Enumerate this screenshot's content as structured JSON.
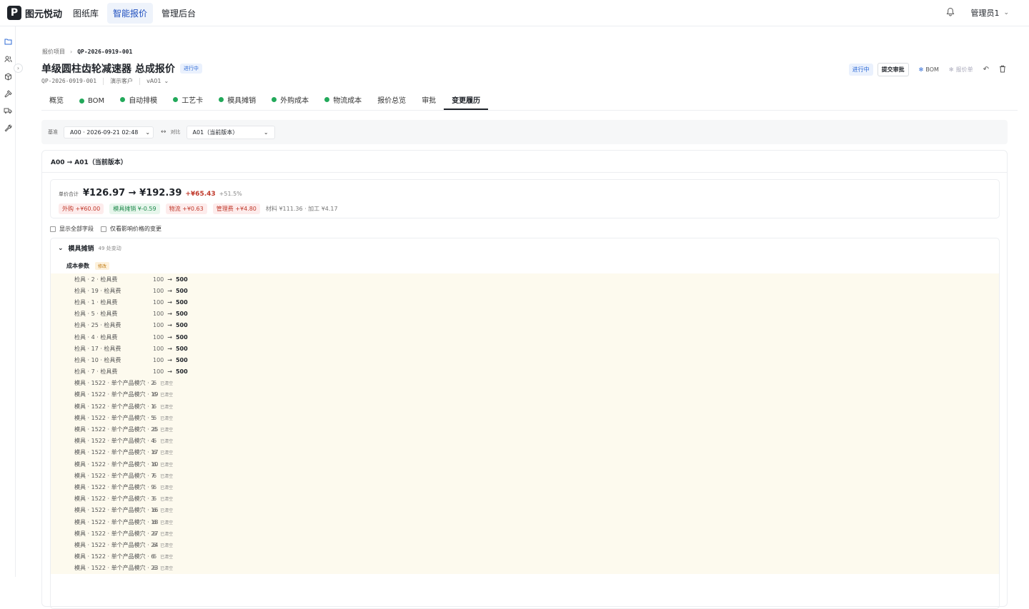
{
  "app": {
    "logo_letter": "P",
    "name": "图元悦动"
  },
  "nav": [
    {
      "label": "图纸库",
      "active": false
    },
    {
      "label": "智能报价",
      "active": true
    },
    {
      "label": "管理后台",
      "active": false
    }
  ],
  "user": {
    "name": "管理员1"
  },
  "breadcrumb": {
    "parent": "报价项目",
    "current": "QP-2026-0919-001"
  },
  "header": {
    "title": "单级圆柱齿轮减速器 总成报价",
    "status": "进行中",
    "code": "QP-2026-0919-001",
    "customer": "演示客户",
    "version": "vA01"
  },
  "actions": {
    "status": "进行中",
    "submit": "提交审批",
    "bom": "BOM",
    "quote_sheet": "报价单"
  },
  "tabs": [
    {
      "label": "概览",
      "dot": false
    },
    {
      "label": "BOM",
      "dot": true
    },
    {
      "label": "自动排模",
      "dot": true
    },
    {
      "label": "工艺卡",
      "dot": true
    },
    {
      "label": "模具摊销",
      "dot": true
    },
    {
      "label": "外购成本",
      "dot": true
    },
    {
      "label": "物流成本",
      "dot": true
    },
    {
      "label": "报价总览",
      "dot": false
    },
    {
      "label": "审批",
      "dot": false
    },
    {
      "label": "变更履历",
      "dot": false,
      "active": true
    }
  ],
  "filter": {
    "base_label": "基准",
    "base_value": "A00 · 2026-09-21 02:48",
    "compare_label": "对比",
    "compare_value": "A01（当前版本）"
  },
  "diff": {
    "heading": "A00 → A01（当前版本）",
    "summary": {
      "label": "单价合计",
      "price": "¥126.97 → ¥192.39",
      "delta": "+¥65.43",
      "pct": "+51.5%",
      "chips": [
        {
          "text": "外购 +¥60.00",
          "tone": "red"
        },
        {
          "text": "模具摊销 ¥-0.59",
          "tone": "green"
        },
        {
          "text": "物流 +¥0.63",
          "tone": "red"
        },
        {
          "text": "管理费 +¥4.80",
          "tone": "red"
        }
      ],
      "extra": "材料 ¥111.36 · 加工 ¥4.17"
    },
    "options": {
      "show_all": "显示全部字段",
      "price_only": "仅看影响价格的变更"
    },
    "section": {
      "title": "模具摊销",
      "count": "49 处变动",
      "group": {
        "title": "成本参数",
        "badge": "修改"
      },
      "changes": [
        {
          "name": "检具 · 2 · 检具费",
          "from": "100",
          "to": "500"
        },
        {
          "name": "检具 · 19 · 检具费",
          "from": "100",
          "to": "500"
        },
        {
          "name": "检具 · 1 · 检具费",
          "from": "100",
          "to": "500"
        },
        {
          "name": "检具 · 5 · 检具费",
          "from": "100",
          "to": "500"
        },
        {
          "name": "检具 · 25 · 检具费",
          "from": "100",
          "to": "500"
        },
        {
          "name": "检具 · 4 · 检具费",
          "from": "100",
          "to": "500"
        },
        {
          "name": "检具 · 17 · 检具费",
          "from": "100",
          "to": "500"
        },
        {
          "name": "检具 · 10 · 检具费",
          "from": "100",
          "to": "500"
        },
        {
          "name": "检具 · 7 · 检具费",
          "from": "100",
          "to": "500"
        },
        {
          "name": "模具 · 1522 · 单个产品模穴 · 2",
          "from": "6",
          "cleared": "已清空"
        },
        {
          "name": "模具 · 1522 · 单个产品模穴 · 19",
          "from": "6",
          "cleared": "已清空"
        },
        {
          "name": "模具 · 1522 · 单个产品模穴 · 1",
          "from": "6",
          "cleared": "已清空"
        },
        {
          "name": "模具 · 1522 · 单个产品模穴 · 5",
          "from": "6",
          "cleared": "已清空"
        },
        {
          "name": "模具 · 1522 · 单个产品模穴 · 25",
          "from": "6",
          "cleared": "已清空"
        },
        {
          "name": "模具 · 1522 · 单个产品模穴 · 4",
          "from": "6",
          "cleared": "已清空"
        },
        {
          "name": "模具 · 1522 · 单个产品模穴 · 17",
          "from": "6",
          "cleared": "已清空"
        },
        {
          "name": "模具 · 1522 · 单个产品模穴 · 10",
          "from": "6",
          "cleared": "已清空"
        },
        {
          "name": "模具 · 1522 · 单个产品模穴 · 7",
          "from": "6",
          "cleared": "已清空"
        },
        {
          "name": "模具 · 1522 · 单个产品模穴 · 9",
          "from": "6",
          "cleared": "已清空"
        },
        {
          "name": "模具 · 1522 · 单个产品模穴 · 3",
          "from": "6",
          "cleared": "已清空"
        },
        {
          "name": "模具 · 1522 · 单个产品模穴 · 16",
          "from": "6",
          "cleared": "已清空"
        },
        {
          "name": "模具 · 1522 · 单个产品模穴 · 18",
          "from": "6",
          "cleared": "已清空"
        },
        {
          "name": "模具 · 1522 · 单个产品模穴 · 27",
          "from": "6",
          "cleared": "已清空"
        },
        {
          "name": "模具 · 1522 · 单个产品模穴 · 24",
          "from": "6",
          "cleared": "已清空"
        },
        {
          "name": "模具 · 1522 · 单个产品模穴 · 6",
          "from": "6",
          "cleared": "已清空"
        },
        {
          "name": "模具 · 1522 · 单个产品模穴 · 23",
          "from": "6",
          "cleared": "已清空"
        }
      ]
    }
  },
  "colors": {
    "accent": "#2f6bd6",
    "tab_dot": "#22a95a",
    "increase": "#c0392b",
    "decrease": "#1f8a4c",
    "changed_row_bg": "#fdfaee"
  }
}
